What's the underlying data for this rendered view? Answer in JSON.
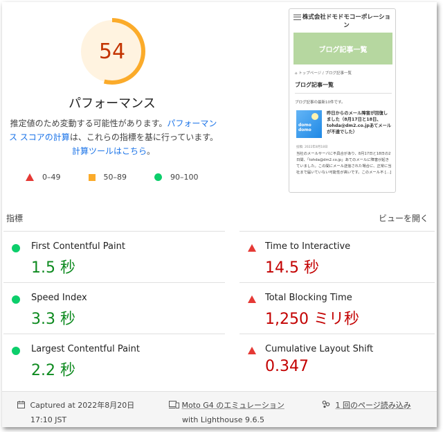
{
  "score": {
    "value": "54",
    "fraction": 0.54,
    "color": "#fbab2a",
    "title": "パフォーマンス"
  },
  "description": {
    "part1": "推定値のため変動する可能性があります。",
    "link1": "パフォーマンス スコアの計算",
    "part2": "は、これらの指標を基に行っています。",
    "link2": "計算ツールはこちら",
    "part3": "。"
  },
  "legend": [
    {
      "icon": "red-triangle-icon",
      "label": "0–49"
    },
    {
      "icon": "orange-square-icon",
      "label": "50–89"
    },
    {
      "icon": "green-circle-icon",
      "label": "90–100"
    }
  ],
  "thumbnail": {
    "site_title": "株式会社ドモドモコーポレーション",
    "banner": "ブログ記事一覧",
    "breadcrumb": "トップページ / ブログ記事一覧",
    "section": "ブログ記事一覧",
    "count": "ブログ記事の最新10件です。",
    "image_text": "domo domo",
    "card_title": "昨日からのメール障害が回復しました（8月17日と18日、tohda@dm2.co.jpあてメールが不達でした）",
    "card_date": "投稿: 2022年8月18日",
    "card_body": "当社のメールサーバに不具合があり、8月17日と18日の2日間、「tohda@dm2.co.jp」あてのメールに障害が起きていました。この間にメール送信された場合に、正常に当社まで届いていない可能性が高いです。このメール不 [...]"
  },
  "metrics_header": {
    "label": "指標",
    "toggle": "ビューを開く"
  },
  "metrics": [
    {
      "name": "First Contentful Paint",
      "value": "1.5 秒",
      "status": "pass"
    },
    {
      "name": "Time to Interactive",
      "value": "14.5 秒",
      "status": "fail"
    },
    {
      "name": "Speed Index",
      "value": "3.3 秒",
      "status": "pass"
    },
    {
      "name": "Total Blocking Time",
      "value": "1,250 ミリ秒",
      "status": "fail"
    },
    {
      "name": "Largest Contentful Paint",
      "value": "2.2 秒",
      "status": "pass"
    },
    {
      "name": "Cumulative Layout Shift",
      "value": "0.347",
      "status": "fail"
    }
  ],
  "footer": {
    "captured": "Captured at 2022年8月20日",
    "time": "17:10 JST",
    "device": "Moto G4 のエミュレーション",
    "lighthouse": "with Lighthouse 9.6.5",
    "load": "1 回のページ読み込み"
  },
  "colors": {
    "pass": "#0d8a1f",
    "fail": "#c30000",
    "link": "#1a73e8"
  }
}
